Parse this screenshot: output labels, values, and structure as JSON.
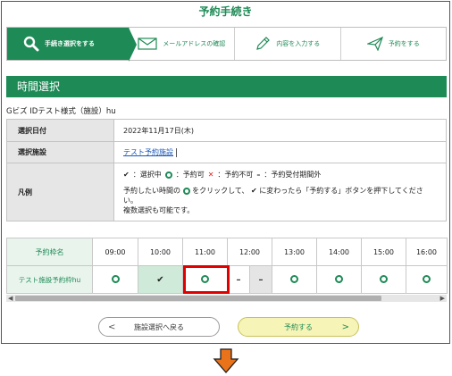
{
  "header": {
    "title": "予約手続き"
  },
  "steps": [
    {
      "label": "手続き選択をする",
      "icon": "search-icon",
      "active": true
    },
    {
      "label": "メールアドレスの確認",
      "icon": "envelope-icon",
      "active": false
    },
    {
      "label": "内容を入力する",
      "icon": "pencil-icon",
      "active": false
    },
    {
      "label": "予約をする",
      "icon": "paper-plane-icon",
      "active": false
    }
  ],
  "section": {
    "title": "時間選択"
  },
  "facility": {
    "name": "Gビズ IDテスト様式（施設）hu"
  },
  "info": {
    "date_label": "選択日付",
    "date_value": "2022年11月17日(木)",
    "facility_label": "選択施設",
    "facility_value": "テスト予約施設",
    "legend_label": "凡例",
    "legend_selected": "：選択中",
    "legend_available": "：予約可",
    "legend_unavailable": "：予約不可",
    "legend_outside": "：予約受付期間外",
    "legend_note_1": "予約したい時間の",
    "legend_note_2": "をクリックして、",
    "legend_note_3": "に変わったら「予約する」ボタンを押下してください。",
    "legend_note_4": "複数選択も可能です。"
  },
  "timetable": {
    "name_header": "予約枠名",
    "times": [
      "09:00",
      "10:00",
      "11:00",
      "12:00",
      "13:00",
      "14:00",
      "15:00",
      "16:00"
    ],
    "row_name": "テスト施設予約枠hu",
    "cells": [
      "available",
      "selected",
      "available",
      "unavailable",
      "unavailable",
      "available",
      "available",
      "available",
      "available"
    ]
  },
  "buttons": {
    "back": "施設選択へ戻る",
    "next": "予約する"
  },
  "colors": {
    "brand_green": "#1e8a56",
    "highlight_red": "#e00000",
    "down_arrow": "#e8731a"
  }
}
